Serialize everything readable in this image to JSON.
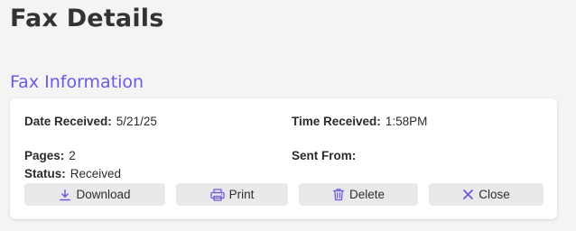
{
  "page": {
    "title": "Fax Details"
  },
  "section": {
    "title": "Fax Information"
  },
  "details": {
    "date_received_label": "Date Received:",
    "date_received_value": "5/21/25",
    "time_received_label": "Time Received:",
    "time_received_value": "1:58PM",
    "pages_label": "Pages:",
    "pages_value": "2",
    "sent_from_label": "Sent From:",
    "sent_from_value": "",
    "status_label": "Status:",
    "status_value": "Received"
  },
  "actions": {
    "download_label": "Download",
    "download_icon": "download-icon",
    "print_label": "Print",
    "print_icon": "printer-icon",
    "delete_label": "Delete",
    "delete_icon": "trash-icon",
    "close_label": "Close",
    "close_icon": "close-icon"
  },
  "colors": {
    "accent": "#6a5ce0",
    "background": "#f4f4f5",
    "card": "#ffffff",
    "button": "#e9e9ec"
  }
}
